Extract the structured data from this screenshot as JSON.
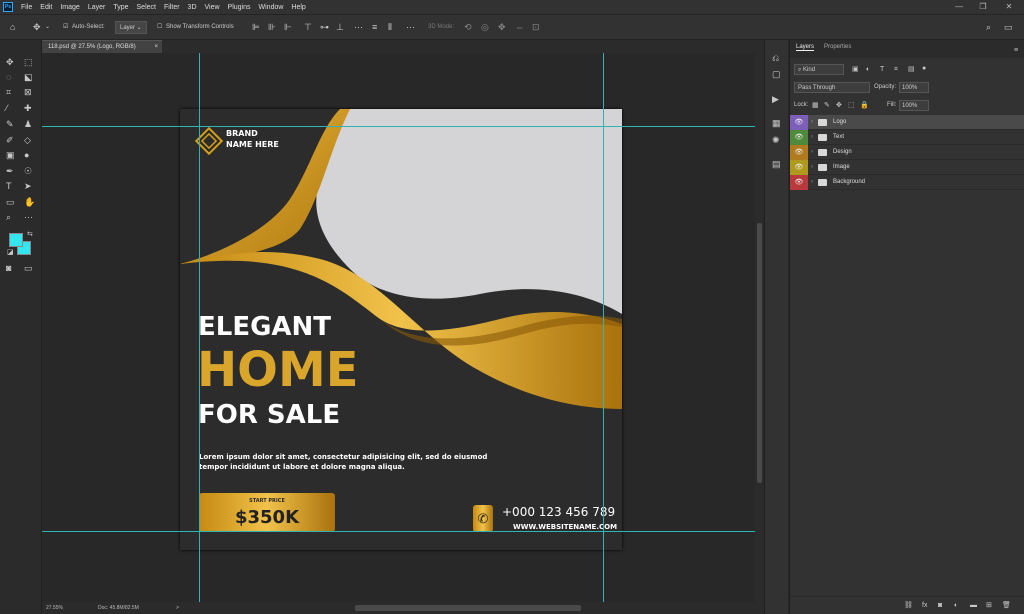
{
  "menu": {
    "items": [
      "File",
      "Edit",
      "Image",
      "Layer",
      "Type",
      "Select",
      "Filter",
      "3D",
      "View",
      "Plugins",
      "Window",
      "Help"
    ]
  },
  "options": {
    "auto_select_label": "Auto-Select:",
    "auto_select_value": "Layer",
    "show_transform_label": "Show Transform Controls",
    "mode_3d_label": "3D Mode:"
  },
  "document": {
    "tab_title": "118.psd @ 27.5% (Logo, RGB/8)",
    "close": "×"
  },
  "status": {
    "zoom": "27.55%",
    "doc_size": "Doc: 45.8M/82.5M",
    "arrow": ">"
  },
  "colors": {
    "foreground": "#33e6f0",
    "background": "#33e6f0",
    "accent_gold": "#d4a017",
    "guide": "#2fb3b3"
  },
  "design": {
    "brand_line1": "BRAND",
    "brand_line2": "NAME HERE",
    "headline1": "ELEGANT",
    "headline2": "HOME",
    "headline3": "FOR SALE",
    "body_line1": "Lorem ipsum dolor sit amet, consectetur adipisicing elit, sed do eiusmod",
    "body_line2": "tempor incididunt ut labore et dolore magna aliqua.",
    "price_label": "START PRICE",
    "price_value": "$350K",
    "phone": "+000 123 456 789",
    "website": "WWW.WEBSITENAME.COM"
  },
  "panel": {
    "tabs": [
      "Layers",
      "Properties"
    ],
    "filter_kind": "Kind",
    "blend_mode": "Pass Through",
    "opacity_label": "Opacity:",
    "opacity_value": "100%",
    "lock_label": "Lock:",
    "fill_label": "Fill:",
    "fill_value": "100%",
    "layers": [
      {
        "name": "Logo",
        "color": "#7c5fb8",
        "selected": true
      },
      {
        "name": "Text",
        "color": "#4f8a3c",
        "selected": false
      },
      {
        "name": "Design",
        "color": "#b07a1e",
        "selected": false
      },
      {
        "name": "Image",
        "color": "#b09a1e",
        "selected": false
      },
      {
        "name": "Background",
        "color": "#b83a3a",
        "selected": false
      }
    ]
  }
}
